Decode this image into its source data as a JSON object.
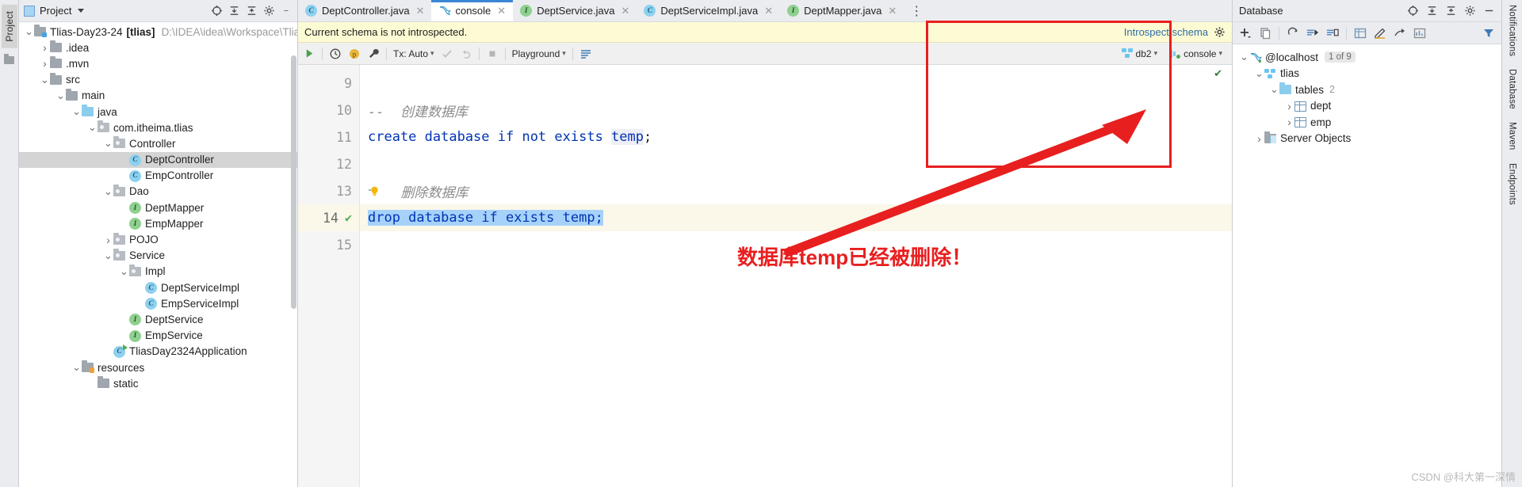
{
  "left_strip": {
    "tab_label": "Project",
    "folder_icon": "folder-icon"
  },
  "project_panel": {
    "title": "Project",
    "toolbar_icons": [
      "target-icon",
      "collapse-all-icon",
      "expand-all-icon",
      "gear-icon",
      "minimize-icon"
    ],
    "tree": [
      {
        "depth": 0,
        "arrow": "v",
        "icon": "folder-src-icon",
        "label": "Tlias-Day23-24",
        "bold_suffix": "[tlias]",
        "path": "D:\\IDEA\\idea\\Workspace\\Tlias",
        "selected": false
      },
      {
        "depth": 1,
        "arrow": ">",
        "icon": "folder-icon",
        "label": ".idea",
        "selected": false
      },
      {
        "depth": 1,
        "arrow": ">",
        "icon": "folder-icon",
        "label": ".mvn",
        "selected": false
      },
      {
        "depth": 1,
        "arrow": "v",
        "icon": "folder-icon",
        "label": "src",
        "selected": false
      },
      {
        "depth": 2,
        "arrow": "v",
        "icon": "folder-icon",
        "label": "main",
        "selected": false
      },
      {
        "depth": 3,
        "arrow": "v",
        "icon": "folder-blue-icon",
        "label": "java",
        "selected": false
      },
      {
        "depth": 4,
        "arrow": "v",
        "icon": "package-icon",
        "label": "com.itheima.tlias",
        "selected": false
      },
      {
        "depth": 5,
        "arrow": "v",
        "icon": "package-icon",
        "label": "Controller",
        "selected": false
      },
      {
        "depth": 6,
        "arrow": "",
        "icon": "class-icon",
        "label": "DeptController",
        "selected": true
      },
      {
        "depth": 6,
        "arrow": "",
        "icon": "class-icon",
        "label": "EmpController",
        "selected": false
      },
      {
        "depth": 5,
        "arrow": "v",
        "icon": "package-icon",
        "label": "Dao",
        "selected": false
      },
      {
        "depth": 6,
        "arrow": "",
        "icon": "interface-icon",
        "label": "DeptMapper",
        "selected": false
      },
      {
        "depth": 6,
        "arrow": "",
        "icon": "interface-icon",
        "label": "EmpMapper",
        "selected": false
      },
      {
        "depth": 5,
        "arrow": ">",
        "icon": "package-icon",
        "label": "POJO",
        "selected": false
      },
      {
        "depth": 5,
        "arrow": "v",
        "icon": "package-icon",
        "label": "Service",
        "selected": false
      },
      {
        "depth": 6,
        "arrow": "v",
        "icon": "package-icon",
        "label": "Impl",
        "selected": false
      },
      {
        "depth": 7,
        "arrow": "",
        "icon": "class-icon",
        "label": "DeptServiceImpl",
        "selected": false
      },
      {
        "depth": 7,
        "arrow": "",
        "icon": "class-icon",
        "label": "EmpServiceImpl",
        "selected": false
      },
      {
        "depth": 6,
        "arrow": "",
        "icon": "interface-icon",
        "label": "DeptService",
        "selected": false
      },
      {
        "depth": 6,
        "arrow": "",
        "icon": "interface-icon",
        "label": "EmpService",
        "selected": false
      },
      {
        "depth": 5,
        "arrow": "",
        "icon": "spring-boot-class-icon",
        "label": "TliasDay2324Application",
        "selected": false
      },
      {
        "depth": 3,
        "arrow": "v",
        "icon": "folder-resources-icon",
        "label": "resources",
        "selected": false
      },
      {
        "depth": 4,
        "arrow": "",
        "icon": "folder-icon",
        "label": "static",
        "selected": false
      }
    ]
  },
  "editor": {
    "tabs": [
      {
        "label": "DeptController.java",
        "icon": "class-icon",
        "active": false
      },
      {
        "label": "console",
        "icon": "mysql-dolphin-icon",
        "active": true
      },
      {
        "label": "DeptService.java",
        "icon": "interface-icon",
        "active": false
      },
      {
        "label": "DeptServiceImpl.java",
        "icon": "class-icon",
        "active": false
      },
      {
        "label": "DeptMapper.java",
        "icon": "interface-icon",
        "active": false
      }
    ],
    "tab_overflow_icon": "more-vertical-icon",
    "notice": {
      "message": "Current schema is not introspected.",
      "action_label": "Introspect schema",
      "settings_icon": "gear-icon",
      "background": "#fdfbd4"
    },
    "sql_toolbar": {
      "run_icon": "run-green-triangle-icon",
      "history_icon": "history-clock-icon",
      "profile_icon": "p-circle-icon",
      "wrench_icon": "wrench-icon",
      "tx_label": "Tx: Auto",
      "commit_icon": "commit-check-icon",
      "rollback_icon": "rollback-icon",
      "stop_icon": "stop-square-icon",
      "schema_label": "Playground",
      "output_icon": "output-list-icon",
      "datasource_label": "db2",
      "session_label": "console"
    },
    "gutter_lines": [
      "9",
      "10",
      "11",
      "12",
      "13",
      "14",
      "15"
    ],
    "current_line": "14",
    "code_lines": [
      {
        "num": "9",
        "segments": []
      },
      {
        "num": "10",
        "segments": [
          {
            "t": "--  创建数据库",
            "c": "cmt"
          }
        ]
      },
      {
        "num": "11",
        "segments": [
          {
            "t": "create database if not exists ",
            "c": "kw"
          },
          {
            "t": "temp",
            "c": "box"
          },
          {
            "t": ";",
            "c": "plain"
          }
        ]
      },
      {
        "num": "12",
        "segments": []
      },
      {
        "num": "13",
        "segments": [
          {
            "t": "bulb",
            "c": "bulb"
          },
          {
            "t": "  删除数据库",
            "c": "cmt"
          }
        ]
      },
      {
        "num": "14",
        "segments": [
          {
            "t": "drop database if exists temp;",
            "c": "sel-kw"
          }
        ]
      },
      {
        "num": "15",
        "segments": []
      }
    ]
  },
  "database_panel": {
    "title": "Database",
    "header_icons": [
      "target-icon",
      "collapse-all-icon",
      "expand-all-icon",
      "gear-icon",
      "minimize-icon"
    ],
    "toolbar_icons": [
      "add-icon",
      "copy-icon",
      "refresh-icon",
      "run-sql-icon",
      "console-icon",
      "table-icon",
      "edit-icon",
      "jump-icon",
      "chart-icon",
      "filter-icon"
    ],
    "tree": [
      {
        "depth": 0,
        "arrow": "v",
        "icon": "mysql-dolphin-icon",
        "label": "@localhost",
        "chip": "1 of 9"
      },
      {
        "depth": 1,
        "arrow": "v",
        "icon": "schema-icon",
        "label": "tlias",
        "chip": ""
      },
      {
        "depth": 2,
        "arrow": "v",
        "icon": "folder-blue-icon",
        "label": "tables",
        "count": "2"
      },
      {
        "depth": 3,
        "arrow": ">",
        "icon": "table-icon",
        "label": "dept",
        "chip": ""
      },
      {
        "depth": 3,
        "arrow": ">",
        "icon": "table-icon",
        "label": "emp",
        "chip": ""
      },
      {
        "depth": 1,
        "arrow": ">",
        "icon": "server-objects-icon",
        "label": "Server Objects",
        "chip": ""
      }
    ]
  },
  "annotation": {
    "text": "数据库temp已经被删除！",
    "color": "#e81f1f",
    "box_label": "red-highlight-box",
    "arrow_label": "red-arrow"
  },
  "right_strip": {
    "tabs": [
      "Notifications",
      "Database",
      "Maven",
      "Endpoints"
    ]
  },
  "watermark": "CSDN @科大第一深情"
}
